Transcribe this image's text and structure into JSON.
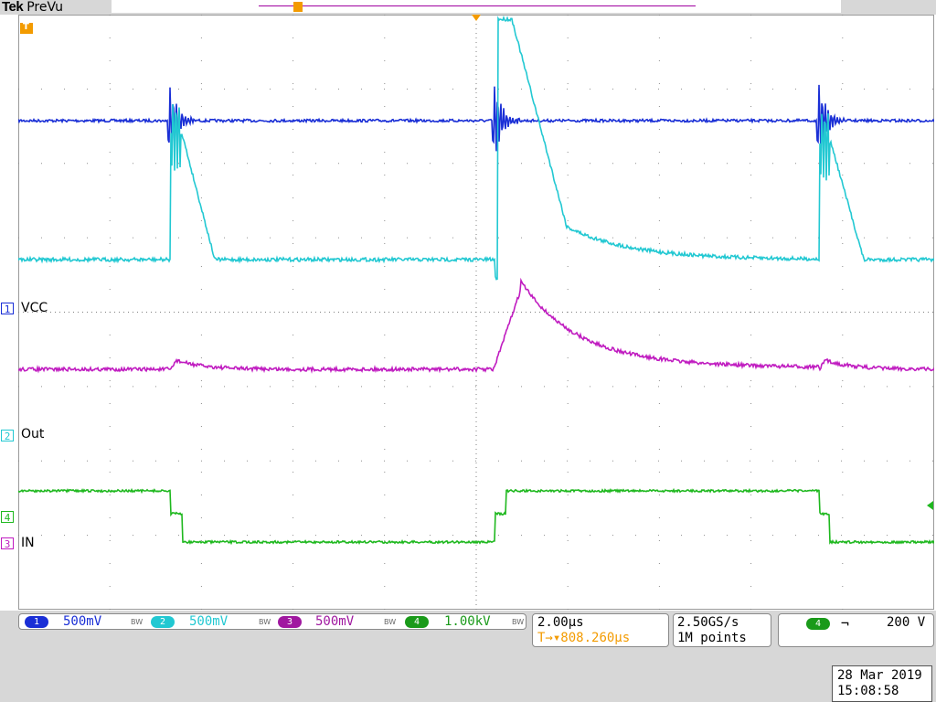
{
  "header": {
    "brand": "Tek",
    "mode": "PreVu"
  },
  "channels": [
    {
      "num": "1",
      "label": "VCC",
      "color": "#1a2fd6",
      "scale": "500mV",
      "bw": "BW"
    },
    {
      "num": "2",
      "label": "Out",
      "color": "#22c8d2",
      "scale": "500mV",
      "bw": "BW"
    },
    {
      "num": "3",
      "label": "IN",
      "color": "#c01cc0",
      "scale": "500mV",
      "bw": "BW"
    },
    {
      "num": "4",
      "label": "",
      "color": "#1fb81f",
      "scale": "1.00kV",
      "bw": "BW"
    }
  ],
  "trigger_marker": "T",
  "timebase": {
    "scale": "2.00µs",
    "position": "808.260µs",
    "position_prefix": "T→▾"
  },
  "acquisition": {
    "rate": "2.50GS/s",
    "length": "1M points"
  },
  "trigger": {
    "source": "4",
    "slope_icon": "falling-edge-icon",
    "slope_glyph": "⌐",
    "level": "200 V"
  },
  "datetime": {
    "date": "28 Mar 2019",
    "time": "15:08:58"
  },
  "colors": {
    "trigger": "#f39b00",
    "grid": "#808080"
  }
}
